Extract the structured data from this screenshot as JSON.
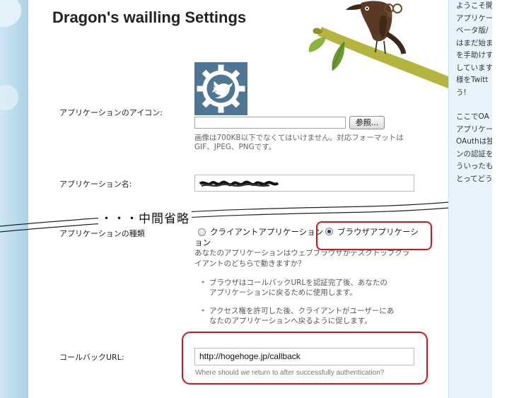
{
  "page": {
    "title": "Dragon's wailling Settings"
  },
  "icon_field": {
    "label": "アプリケーションのアイコン:",
    "browse_label": "参照...",
    "hint_line1": "画像は700KB以下でなくてはいけません。対応フォーマットは",
    "hint_line2": "GIF、JPEG、PNGです。"
  },
  "name_field": {
    "label": "アプリケーション名:",
    "value_redacted": true
  },
  "omission_note": "・・・中間省略",
  "type_field": {
    "label": "アプリケーションの種類",
    "option_client": "クライアントアプリケーション",
    "option_client_wrap": "ョン",
    "option_browser": "ブラウザアプリケーシ",
    "selected": "browser",
    "question_line1": "あなたのアプリケーションはウェブブラウザかデスクトップクラ",
    "question_line2": "イアントのどちらで動きますか？",
    "bullets": [
      {
        "line1": "ブラウザはコールバックURLを認証完了後、あなたの",
        "line2": "アプリケーションに戻るために使用します。"
      },
      {
        "line1": "アクセス権を許可した後、クライアントがユーザーにあ",
        "line2": "なたのアプリケーションへ戻るように促します。"
      }
    ]
  },
  "callback_field": {
    "label": "コールバックURL:",
    "value": "http://hogehoge.jp/callback",
    "hint": "Where should we return to after successfully authentication?"
  },
  "sidebar": {
    "lines_top": [
      "ようこそ開",
      "アプリケー",
      "ベータ版/",
      "はまだ始ま",
      "を手助けす",
      "しています",
      "様をTwitt",
      "う!"
    ],
    "lines_bottom": [
      "ここでOA",
      "アプリケーを登録",
      "OAuthは独",
      "ンの認証を",
      "ういったも",
      "とってどう"
    ]
  },
  "colors": {
    "highlight": "#e0101a",
    "icon_bg": "#4d7795",
    "side_bg": "#e8f3fb"
  }
}
